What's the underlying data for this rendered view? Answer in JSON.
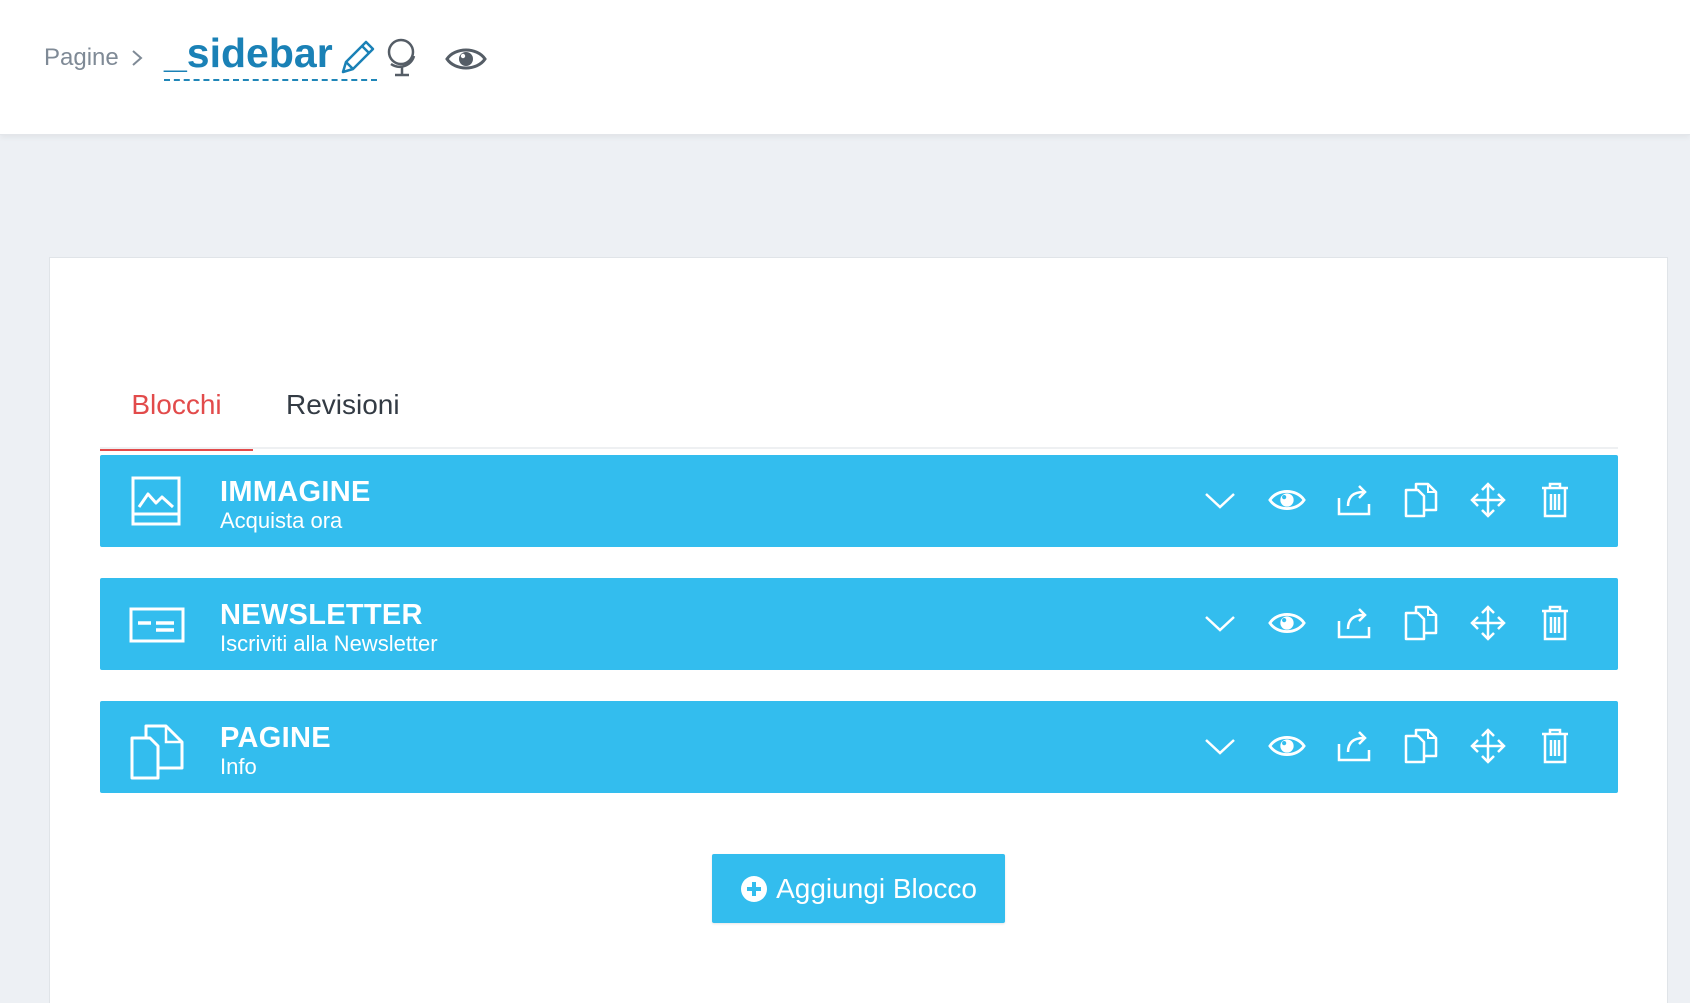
{
  "header": {
    "breadcrumb_root": "Pagine",
    "page_title": "_sidebar"
  },
  "tabs": [
    {
      "label": "Blocchi",
      "active": true
    },
    {
      "label": "Revisioni",
      "active": false
    }
  ],
  "blocks": [
    {
      "title": "IMMAGINE",
      "subtitle": "Acquista ora",
      "icon": "image-icon"
    },
    {
      "title": "NEWSLETTER",
      "subtitle": "Iscriviti alla Newsletter",
      "icon": "newsletter-card-icon"
    },
    {
      "title": "PAGINE",
      "subtitle": "Info",
      "icon": "pages-icon"
    }
  ],
  "block_actions": [
    "chevron-down-icon",
    "eye-icon",
    "share-icon",
    "copy-icon",
    "move-icon",
    "trash-icon"
  ],
  "add_button": {
    "label": "Aggiungi Blocco",
    "icon": "plus-circle-icon"
  },
  "colors": {
    "accent_blue": "#33bdee",
    "title_blue": "#1a81b6",
    "active_tab_red": "#e24b4b",
    "background": "#edf0f4"
  }
}
